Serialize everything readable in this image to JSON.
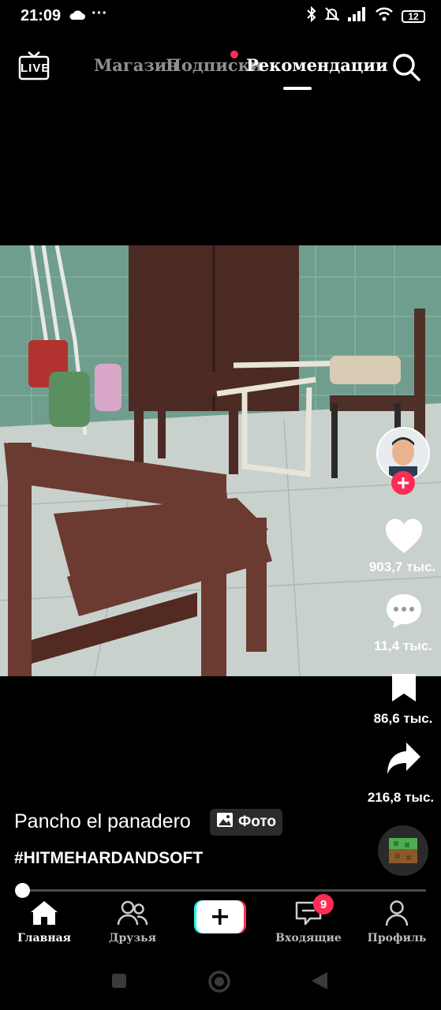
{
  "status": {
    "time": "21:09",
    "dots": "···",
    "battery": "12"
  },
  "top_nav": {
    "live_label": "LIVE",
    "tabs": [
      {
        "label": "Магазин"
      },
      {
        "label": "Подписки"
      },
      {
        "label": "Рекомендации"
      }
    ]
  },
  "rail": {
    "likes": "903,7 тыс.",
    "comments": "11,4 тыс.",
    "saves": "86,6 тыс.",
    "shares": "216,8 тыс."
  },
  "caption": {
    "author": "Pancho el panadero",
    "badge": "Фото",
    "hashtag": "#HITMEHARDANDSOFT"
  },
  "bottom_nav": {
    "home": "Главная",
    "friends": "Друзья",
    "inbox": "Входящие",
    "inbox_badge": "9",
    "profile": "Профиль"
  },
  "colors": {
    "accent": "#fe2c55",
    "cyan": "#25f4ee",
    "background": "#000000"
  }
}
